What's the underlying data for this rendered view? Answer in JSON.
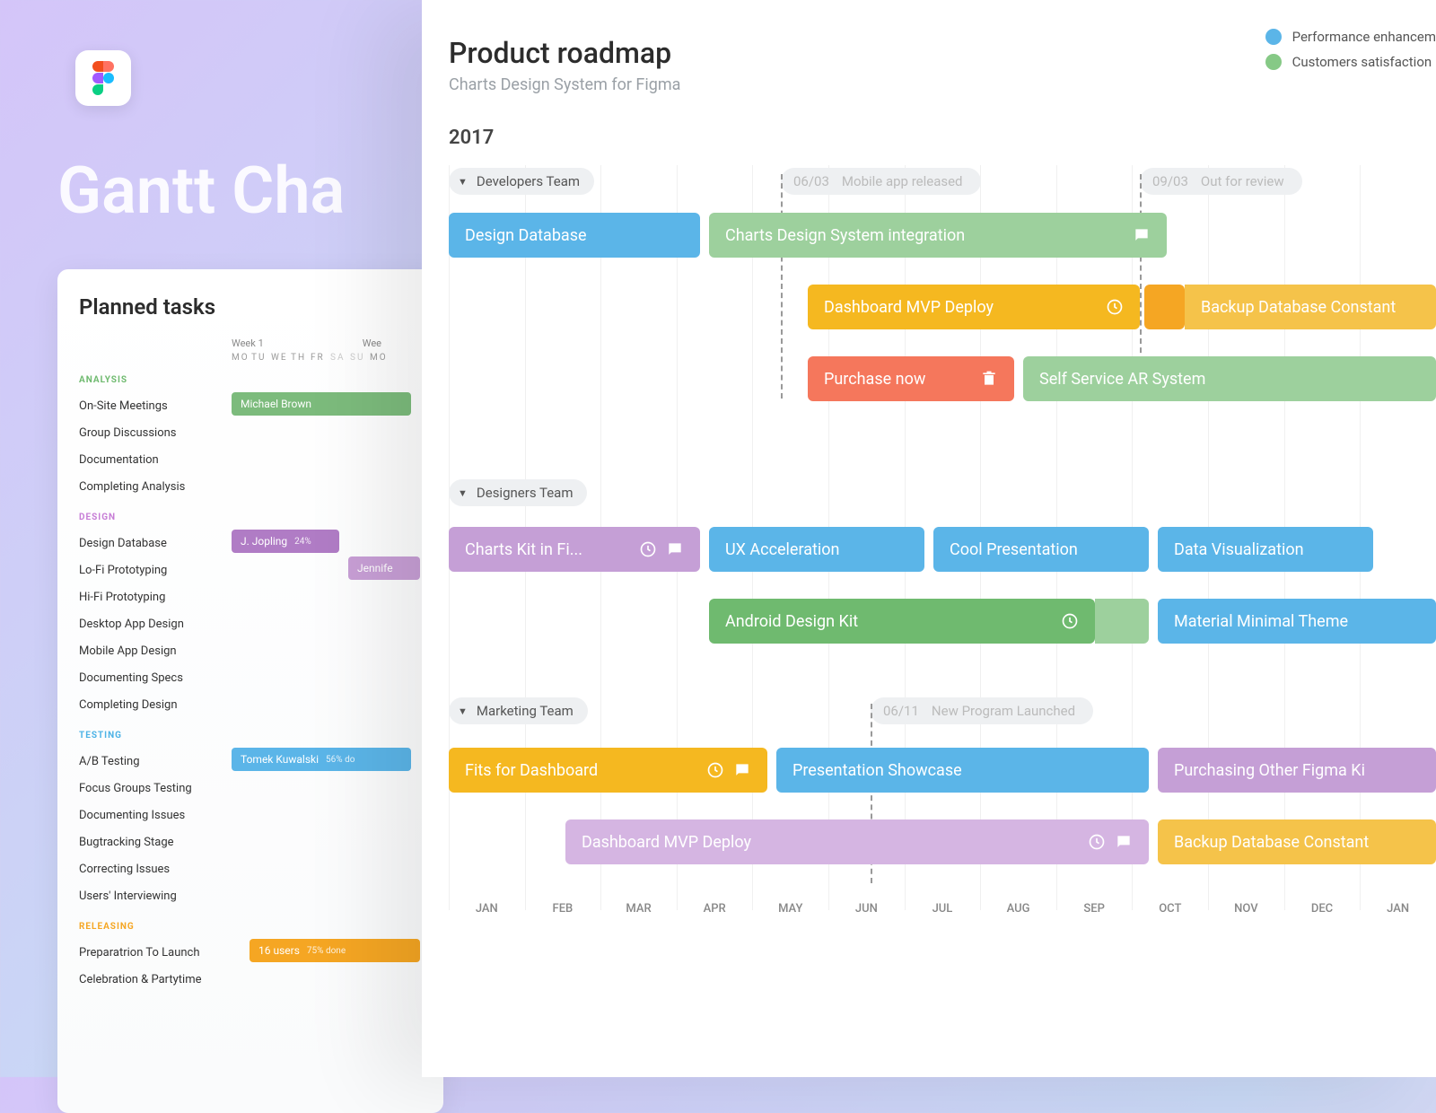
{
  "figma_icon": "figma",
  "gantt_title": "Gantt Cha",
  "left": {
    "title": "Planned tasks",
    "weeks": [
      "Week 1",
      "Wee"
    ],
    "days": [
      "MO",
      "TU",
      "WE",
      "TH",
      "FR",
      "SA",
      "SU",
      "MO"
    ],
    "sections": {
      "analysis": {
        "label": "ANALYSIS",
        "tasks": [
          "On-Site Meetings",
          "Group Discussions",
          "Documentation",
          "Completing Analysis"
        ]
      },
      "design": {
        "label": "DESIGN",
        "tasks": [
          "Design Database",
          "Lo-Fi Prototyping",
          "Hi-Fi Prototyping",
          "Desktop App Design",
          "Mobile App Design",
          "Documenting Specs",
          "Completing Design"
        ]
      },
      "testing": {
        "label": "TESTING",
        "tasks": [
          "A/B Testing",
          "Focus Groups Testing",
          "Documenting Issues",
          "Bugtracking Stage",
          "Correcting Issues",
          "Users' Interviewing"
        ]
      },
      "releasing": {
        "label": "RELEASING",
        "tasks": [
          "Preparatrion To Launch",
          "Celebration & Partytime"
        ]
      }
    },
    "bars": {
      "michael": {
        "label": "Michael Brown"
      },
      "jopling": {
        "label": "J. Jopling",
        "pct": "24%"
      },
      "jennifer": {
        "label": "Jennife"
      },
      "tomek": {
        "label": "Tomek Kuwalski",
        "pct": "56% do"
      },
      "users": {
        "label": "16 users",
        "pct": "75% done"
      }
    }
  },
  "main": {
    "title": "Product roadmap",
    "subtitle": "Charts Design System for Figma",
    "legend": {
      "perf": "Performance enhancem",
      "cust": "Customers satisfaction"
    },
    "year": "2017",
    "months": [
      "JAN",
      "FEB",
      "MAR",
      "APR",
      "MAY",
      "JUN",
      "JUL",
      "AUG",
      "SEP",
      "OCT",
      "NOV",
      "DEC",
      "JAN"
    ],
    "groups": {
      "dev": {
        "label": "Developers Team"
      },
      "des": {
        "label": "Designers Team"
      },
      "mkt": {
        "label": "Marketing Team"
      }
    },
    "milestones": {
      "m1": {
        "date": "06/03",
        "label": "Mobile app released"
      },
      "m2": {
        "date": "09/03",
        "label": "Out for review"
      },
      "m3": {
        "date": "06/11",
        "label": "New Program Launched"
      }
    },
    "bars": {
      "b1": "Design Database",
      "b2": "Charts Design System integration",
      "b3": "Dashboard MVP Deploy",
      "b4": "Backup Database Constant",
      "b5": "Purchase now",
      "b6": "Self Service AR System",
      "b7": "Charts Kit in Fi...",
      "b8": "UX Acceleration",
      "b9": "Cool Presentation",
      "b10": "Data Visualization",
      "b11": "Android Design Kit",
      "b12": "Material Minimal Theme",
      "b13": "Fits for Dashboard",
      "b14": "Presentation Showcase",
      "b15": "Purchasing Other Figma Ki",
      "b16": "Dashboard MVP Deploy",
      "b17": "Backup Database Constant"
    }
  },
  "chart_data": {
    "type": "gantt",
    "title": "Product roadmap",
    "year": 2017,
    "months": [
      "JAN",
      "FEB",
      "MAR",
      "APR",
      "MAY",
      "JUN",
      "JUL",
      "AUG",
      "SEP",
      "OCT",
      "NOV",
      "DEC",
      "JAN"
    ],
    "groups": [
      {
        "name": "Developers Team",
        "milestones": [
          {
            "date": "06/03",
            "label": "Mobile app released"
          },
          {
            "date": "09/03",
            "label": "Out for review"
          }
        ],
        "tasks": [
          {
            "label": "Design Database",
            "start": 0,
            "end": 2.7,
            "color": "blue"
          },
          {
            "label": "Charts Design System integration",
            "start": 2.8,
            "end": 8.0,
            "color": "green"
          },
          {
            "label": "Dashboard MVP Deploy",
            "start": 4.0,
            "end": 8.0,
            "color": "yellow"
          },
          {
            "label": "Backup Database Constant",
            "start": 8.1,
            "end": 13,
            "color": "yellow"
          },
          {
            "label": "Purchase now",
            "start": 4.0,
            "end": 6.4,
            "color": "coral"
          },
          {
            "label": "Self Service AR System",
            "start": 6.5,
            "end": 13,
            "color": "green"
          }
        ]
      },
      {
        "name": "Designers Team",
        "tasks": [
          {
            "label": "Charts Kit in Fi...",
            "start": 0,
            "end": 2.7,
            "color": "purple"
          },
          {
            "label": "UX Acceleration",
            "start": 2.8,
            "end": 5.2,
            "color": "blue"
          },
          {
            "label": "Cool Presentation",
            "start": 5.3,
            "end": 7.8,
            "color": "blue"
          },
          {
            "label": "Data Visualization",
            "start": 8.0,
            "end": 10.4,
            "color": "blue"
          },
          {
            "label": "Android Design Kit",
            "start": 2.8,
            "end": 7.9,
            "color": "green"
          },
          {
            "label": "Material Minimal Theme",
            "start": 8.1,
            "end": 13,
            "color": "blue"
          }
        ]
      },
      {
        "name": "Marketing Team",
        "milestones": [
          {
            "date": "06/11",
            "label": "New Program Launched"
          }
        ],
        "tasks": [
          {
            "label": "Fits for Dashboard",
            "start": 0,
            "end": 3.6,
            "color": "yellow"
          },
          {
            "label": "Presentation Showcase",
            "start": 3.7,
            "end": 7.9,
            "color": "blue"
          },
          {
            "label": "Purchasing Other Figma Ki",
            "start": 8.0,
            "end": 13,
            "color": "purple"
          },
          {
            "label": "Dashboard MVP Deploy",
            "start": 1.4,
            "end": 8.0,
            "color": "purple"
          },
          {
            "label": "Backup Database Constant",
            "start": 8.1,
            "end": 13,
            "color": "yellow"
          }
        ]
      }
    ]
  }
}
